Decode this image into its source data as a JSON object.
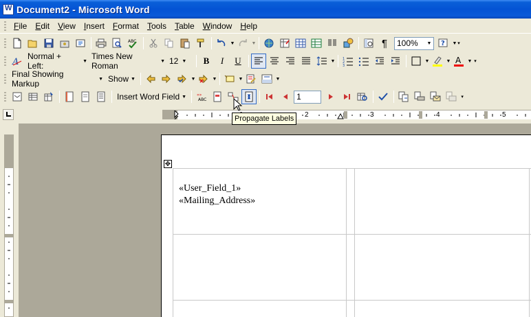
{
  "window": {
    "title": "Document2 - Microsoft Word"
  },
  "menu": [
    {
      "label": "File",
      "ul": "F",
      "rest": "ile"
    },
    {
      "label": "Edit",
      "ul": "E",
      "rest": "dit"
    },
    {
      "label": "View",
      "ul": "V",
      "rest": "iew"
    },
    {
      "label": "Insert",
      "ul": "I",
      "rest": "nsert"
    },
    {
      "label": "Format",
      "ul": "F",
      "rest": "ormat"
    },
    {
      "label": "Tools",
      "ul": "T",
      "rest": "ools"
    },
    {
      "label": "Table",
      "ul": "T",
      "rest": "able"
    },
    {
      "label": "Window",
      "ul": "W",
      "rest": "indow"
    },
    {
      "label": "Help",
      "ul": "H",
      "rest": "elp"
    }
  ],
  "standard_toolbar": {
    "zoom": "100%"
  },
  "formatting_toolbar": {
    "style": "Normal + Left:",
    "font": "Times New Roman",
    "size": "12",
    "bold": "B",
    "italic": "I",
    "underline": "U"
  },
  "reviewing_toolbar": {
    "display_mode": "Final Showing Markup",
    "show_label": "Show"
  },
  "mail_merge_toolbar": {
    "insert_word_field": "Insert Word Field",
    "record_number": "1"
  },
  "tooltip": {
    "text": "Propagate Labels"
  },
  "ruler": {
    "numbers": [
      "1",
      "2",
      "3",
      "4",
      "5"
    ]
  },
  "document": {
    "fields": [
      "«User_Field_1»",
      "«Mailing_Address»"
    ]
  },
  "colors": {
    "title_bar": "#0453d4",
    "chrome": "#ece9d8",
    "workspace": "#aca899",
    "tooltip_bg": "#ffffe1"
  }
}
